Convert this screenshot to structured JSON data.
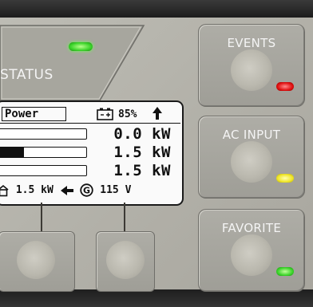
{
  "status": {
    "label": "STATUS",
    "led_color": "#3bd42a"
  },
  "buttons": [
    {
      "label": "EVENTS",
      "led": "red"
    },
    {
      "label": "AC INPUT",
      "led": "yellow"
    },
    {
      "label": "FAVORITE",
      "led": "green"
    }
  ],
  "lcd": {
    "tab": "Power",
    "battery_pct": "85%",
    "rows": [
      {
        "value": "0.0 kW",
        "fill": 0.0
      },
      {
        "value": "1.5 kW",
        "fill": 0.3
      },
      {
        "value": "1.5 kW",
        "fill": 0.0
      }
    ],
    "footer": {
      "load": "1.5 kW",
      "voltage": "115 V"
    }
  },
  "icons": [
    "battery-icon",
    "up-arrow-icon",
    "house-icon",
    "left-arrow-icon",
    "generator-icon"
  ]
}
